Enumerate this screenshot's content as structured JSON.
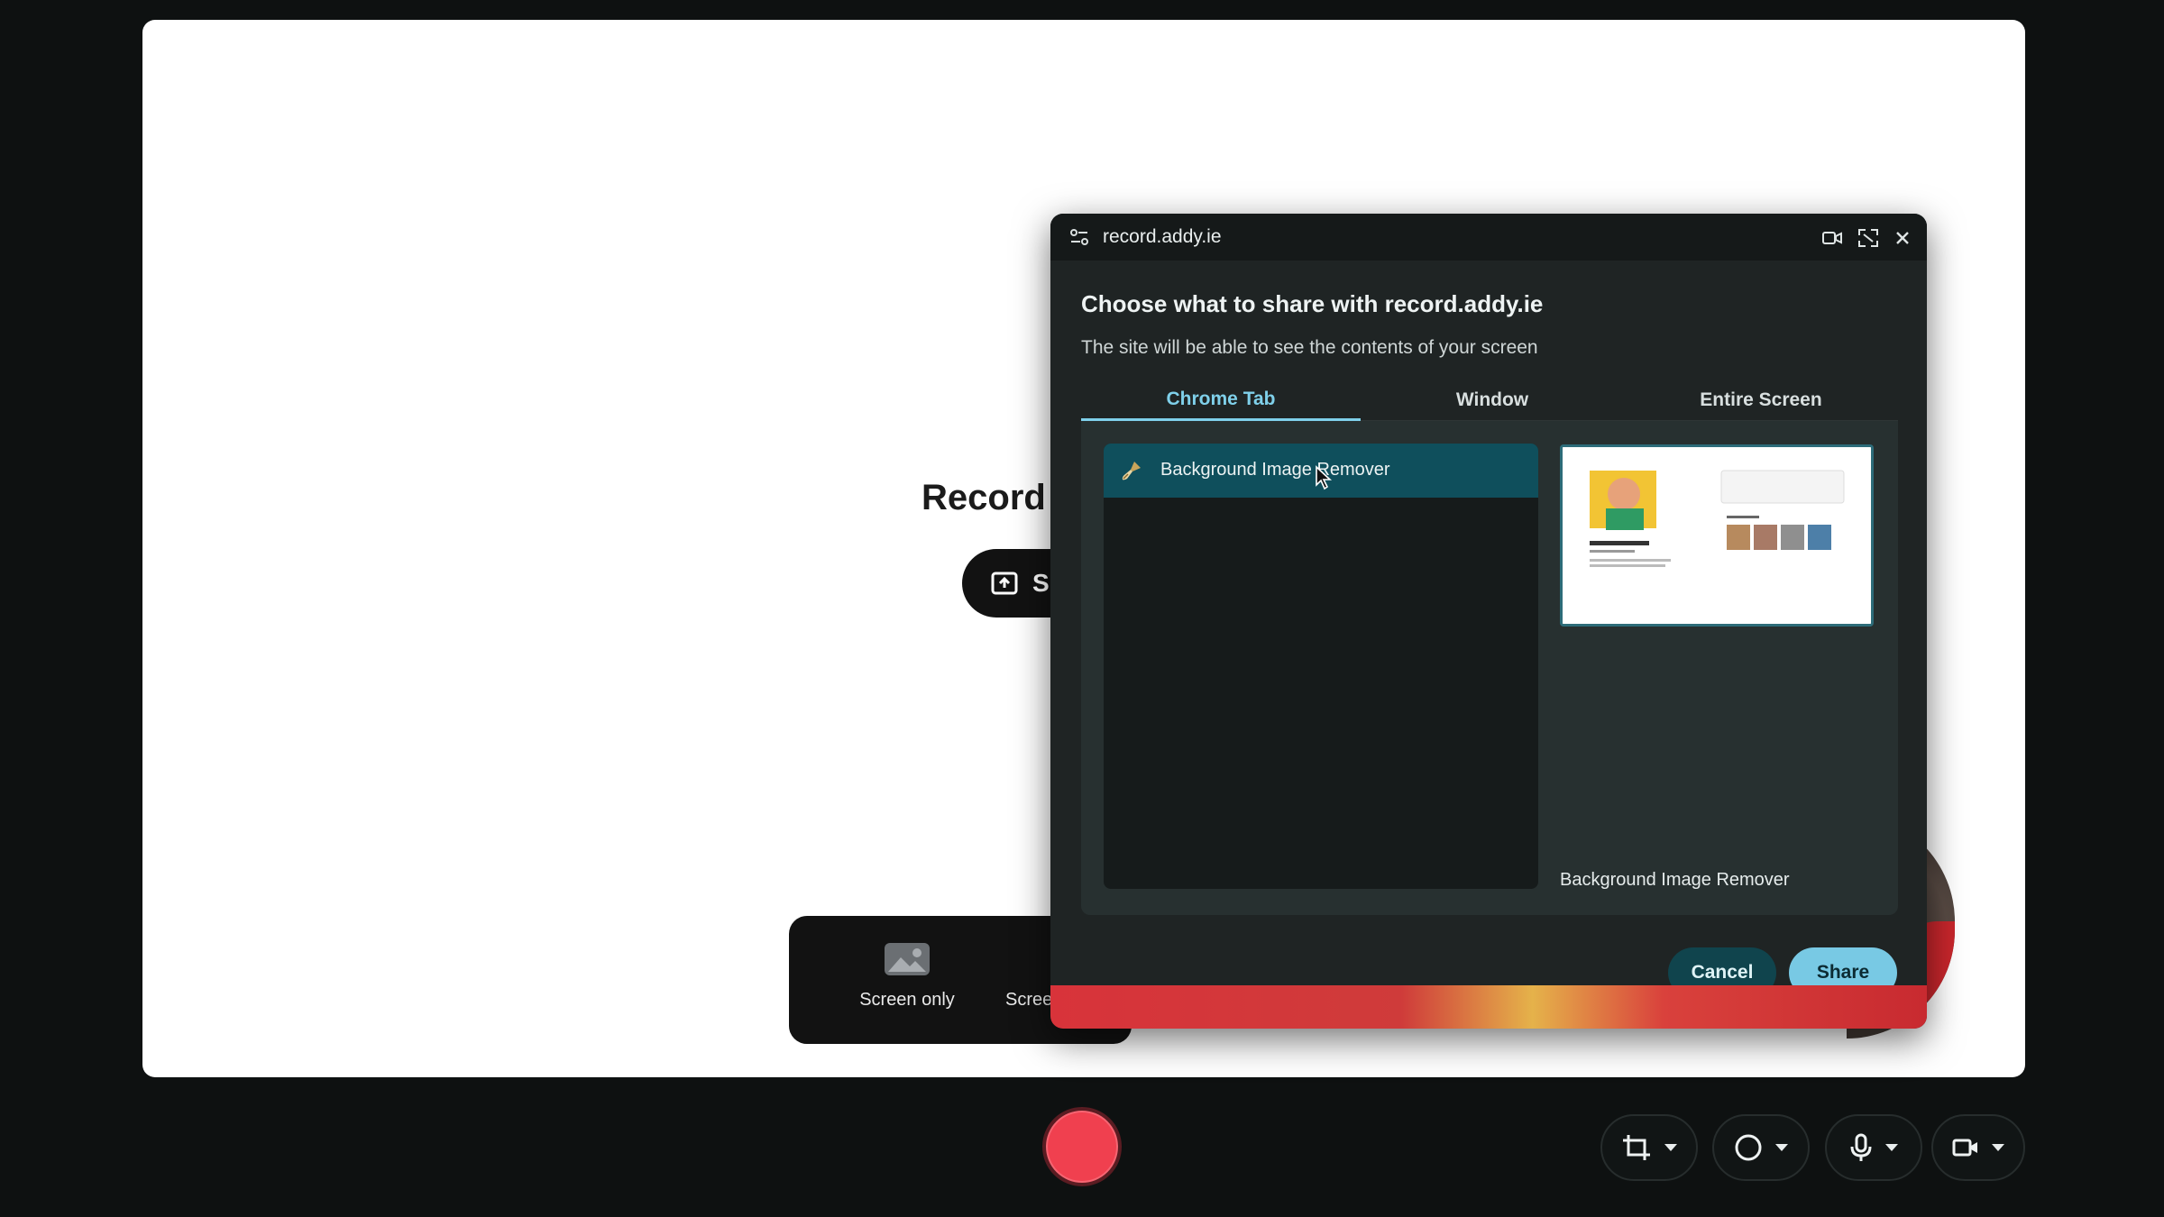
{
  "page": {
    "heading": "Record",
    "share_button_label": "Sh",
    "modes": [
      {
        "label": "Screen only",
        "icon": "image-icon"
      },
      {
        "label": "Scree",
        "icon": "screen-camera-icon"
      }
    ]
  },
  "dialog": {
    "site": "record.addy.ie",
    "heading": "Choose what to share with record.addy.ie",
    "description": "The site will be able to see the contents of your screen",
    "tabs": [
      {
        "label": "Chrome Tab",
        "selected": true
      },
      {
        "label": "Window",
        "selected": false
      },
      {
        "label": "Entire Screen",
        "selected": false
      }
    ],
    "sources": [
      {
        "label": "Background Image Remover",
        "icon": "brush-icon",
        "selected": true
      }
    ],
    "preview_caption": "Background Image Remover",
    "cancel_label": "Cancel",
    "share_label": "Share"
  },
  "toolbar": {
    "controls": [
      {
        "name": "crop-icon"
      },
      {
        "name": "circle-icon"
      },
      {
        "name": "microphone-icon"
      },
      {
        "name": "video-camera-icon"
      }
    ]
  },
  "colors": {
    "accent": "#78c9e4",
    "tab_active": "#7fd0ea",
    "selected_row": "#0f4f5c",
    "record": "#f0404f"
  }
}
